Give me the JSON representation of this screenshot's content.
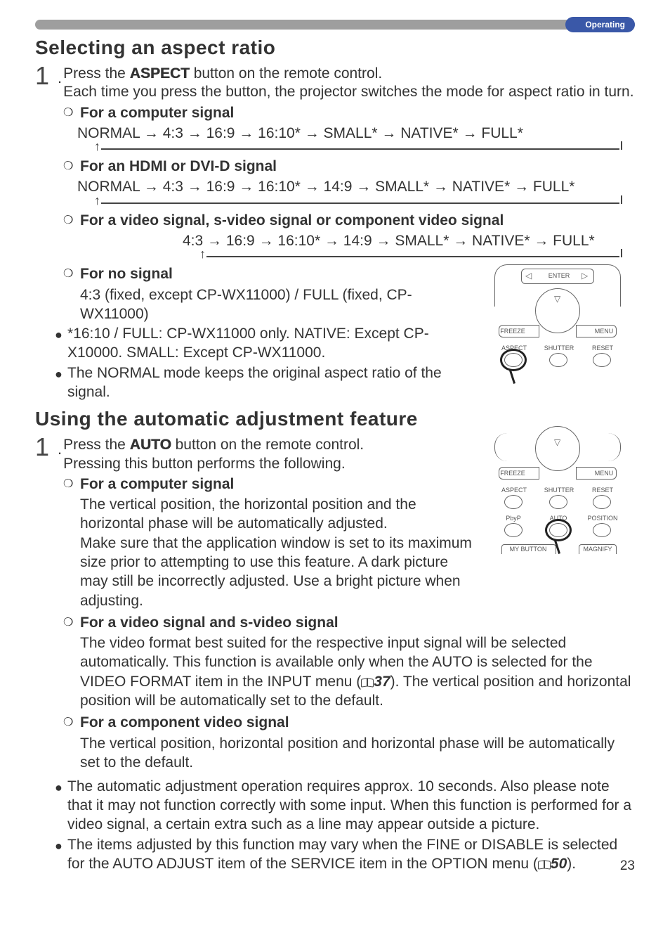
{
  "topbar": {
    "tag": "Operating"
  },
  "pagenum": "23",
  "section1": {
    "title": "Selecting an aspect ratio",
    "step_num": "1",
    "step_dot": ".",
    "step_line1a": "Press the ",
    "step_btn": "ASPECT",
    "step_line1b": " button on the remote control.",
    "step_line2": "Each time you press the button, the projector switches the mode for aspect ratio in turn.",
    "items": {
      "comp": {
        "head": "For a computer signal",
        "seq": "NORMAL → 4:3 → 16:9 → 16:10*      →      SMALL* → NATIVE* → FULL*"
      },
      "hdmi": {
        "head": "For an HDMI or DVI-D signal",
        "seq": "NORMAL → 4:3 → 16:9 → 16:10* → 14:9 → SMALL* → NATIVE* → FULL*"
      },
      "video": {
        "head": "For a video signal, s-video signal or component video signal",
        "seq": "4:3 → 16:9 → 16:10* → 14:9 → SMALL* → NATIVE* → FULL*"
      },
      "nosig": {
        "head": "For no signal",
        "body": "4:3 (fixed, except CP-WX11000) / FULL (fixed, CP-WX11000)"
      }
    },
    "note1": "*16:10 / FULL: CP-WX11000 only. NATIVE: Except CP-X10000. SMALL: Except CP-WX11000.",
    "note2": "The NORMAL mode keeps the original aspect ratio of the signal."
  },
  "section2": {
    "title": "Using the automatic adjustment feature",
    "step_num": "1",
    "step_dot": ".",
    "step_line1a": "Press the ",
    "step_btn": "AUTO",
    "step_line1b": " button on the remote control.",
    "step_line2": "Pressing this button performs the following.",
    "items": {
      "comp": {
        "head": "For a computer signal",
        "body": "The vertical position, the horizontal position and the horizontal phase will be automatically adjusted.\nMake sure that the application window is set to its maximum size prior to attempting to use this feature. A dark picture may still be incorrectly adjusted. Use a bright picture when adjusting."
      },
      "vids": {
        "head": "For a video signal and s-video signal",
        "body_a": "The video format best suited for the respective input signal will be selected automatically. This function is available only when the AUTO is selected for the VIDEO FORMAT item in the INPUT menu (",
        "ref": "37",
        "body_b": "). The vertical position and horizontal position will be automatically set to the default."
      },
      "compv": {
        "head": "For a component video signal",
        "body": "The vertical position, horizontal position and horizontal phase will be automatically set to the default."
      }
    },
    "note1": "The automatic adjustment operation requires approx. 10 seconds. Also please note that it may not function correctly with some input. When this function is performed for a video signal, a certain extra such as a line may appear outside a picture.",
    "note2a": "The items adjusted by this function may vary when the FINE or DISABLE is selected for the AUTO ADJUST item of the SERVICE item in the OPTION menu (",
    "note2_ref": "50",
    "note2b": ")."
  },
  "remote_labels": {
    "enter": "ENTER",
    "freeze": "FREEZE",
    "menu": "MENU",
    "aspect": "ASPECT",
    "shutter": "SHUTTER",
    "reset": "RESET",
    "pbyp": "PbyP",
    "auto": "AUTO",
    "position": "POSITION",
    "mybutton": "MY BUTTON",
    "magnify": "MAGNIFY"
  }
}
